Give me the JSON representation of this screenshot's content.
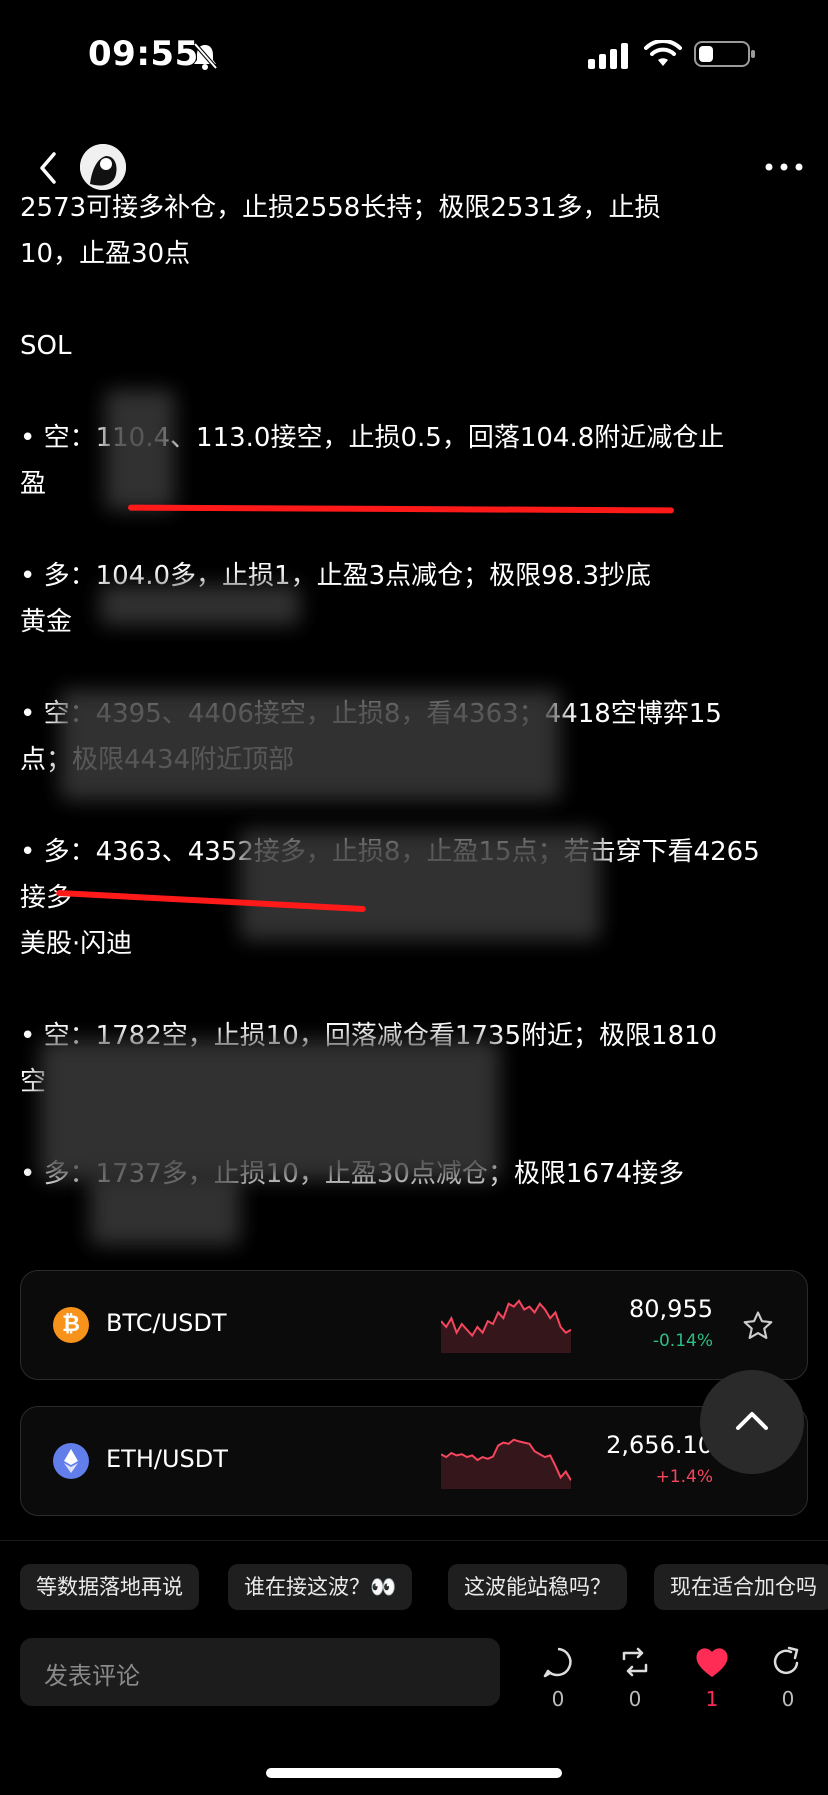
{
  "status_bar": {
    "time": "09:55"
  },
  "post": {
    "lines": [
      "2573可接多补仓，止损2558长持；极限2531多，止损",
      "10，止盈30点",
      "",
      "SOL",
      "",
      "• 空：110.4、113.0接空，止损0.5，回落104.8附近减仓止",
      "盈",
      "",
      "• 多：104.0多，止损1，止盈3点减仓；极限98.3抄底",
      "黄金",
      "",
      "• 空：4395、4406接空，止损8，看4363；4418空博弈15",
      "点；极限4434附近顶部",
      "",
      "• 多：4363、4352接多，止损8，止盈15点；若击穿下看4265",
      "接多",
      "美股·闪迪",
      "",
      "• 空：1782空，止损10，回落减仓看1735附近；极限1810",
      "空",
      "",
      "• 多：1737多，止损10，止盈30点减仓；极限1674接多"
    ]
  },
  "tickers": [
    {
      "pair": "BTC/USDT",
      "price": "80,955",
      "change": "-0.14%",
      "icon": "bitcoin-icon",
      "color": "#f7931a",
      "change_color": "#2ebd85",
      "spark": [
        0.55,
        0.45,
        0.6,
        0.35,
        0.5,
        0.4,
        0.3,
        0.45,
        0.35,
        0.55,
        0.5,
        0.7,
        0.6,
        0.85,
        0.8,
        0.9,
        0.75,
        0.8,
        0.7,
        0.85,
        0.75,
        0.6,
        0.7,
        0.45,
        0.35,
        0.4
      ]
    },
    {
      "pair": "ETH/USDT",
      "price": "2,656.10",
      "change": "+1.4%",
      "icon": "ethereum-icon",
      "color": "#627eea",
      "change_color": "#f6465d",
      "spark": [
        0.6,
        0.55,
        0.62,
        0.58,
        0.6,
        0.55,
        0.58,
        0.5,
        0.55,
        0.52,
        0.56,
        0.75,
        0.8,
        0.78,
        0.85,
        0.82,
        0.8,
        0.78,
        0.65,
        0.6,
        0.55,
        0.58,
        0.4,
        0.2,
        0.3,
        0.15
      ]
    }
  ],
  "quick_replies": [
    "等数据落地再说",
    "谁在接这波？👀",
    "这波能站稳吗？",
    "现在适合加仓吗"
  ],
  "comment": {
    "placeholder": "发表评论"
  },
  "actions": [
    {
      "name": "comment-icon",
      "count": "0"
    },
    {
      "name": "repost-icon",
      "count": "0"
    },
    {
      "name": "like-icon",
      "count": "1"
    },
    {
      "name": "share-icon",
      "count": "0"
    }
  ],
  "colors": {
    "accent_red": "#ff1a1a",
    "like": "#ff2d55"
  }
}
